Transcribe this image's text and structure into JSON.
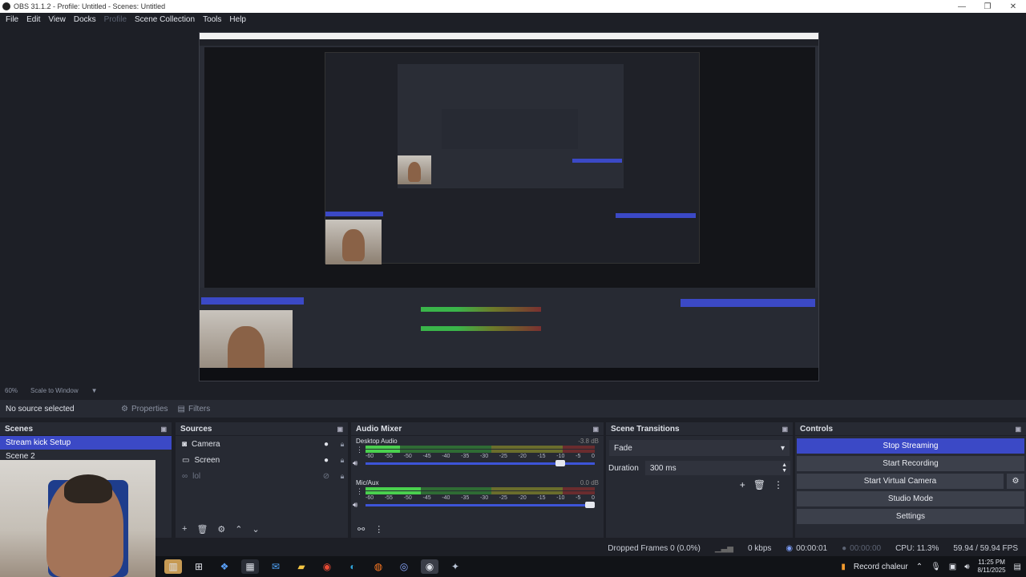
{
  "window": {
    "title": "OBS 31.1.2 - Profile: Untitled - Scenes: Untitled",
    "minimize": "—",
    "maximize": "❐",
    "close": "✕"
  },
  "menu": [
    "File",
    "Edit",
    "View",
    "Docks",
    "Profile",
    "Scene Collection",
    "Tools",
    "Help"
  ],
  "zoom": {
    "percent": "60%",
    "mode": "Scale to Window",
    "chevron": "▼"
  },
  "props": {
    "no_source": "No source selected",
    "properties": "Properties",
    "filters": "Filters"
  },
  "scenes": {
    "title": "Scenes",
    "items": [
      "Stream kick Setup",
      "Scene 2"
    ]
  },
  "sources": {
    "title": "Sources",
    "items": [
      {
        "name": "Camera",
        "icon": "camera-icon"
      },
      {
        "name": "Screen",
        "icon": "monitor-icon"
      },
      {
        "name": "lol",
        "icon": "link-icon"
      }
    ]
  },
  "mixer": {
    "title": "Audio Mixer",
    "channels": [
      {
        "name": "Desktop Audio",
        "db": "-3.8 dB",
        "level": 0.15,
        "volume": 0.87
      },
      {
        "name": "Mic/Aux",
        "db": "0.0 dB",
        "level": 0.24,
        "volume": 1.0
      }
    ],
    "scale": [
      "-60",
      "-55",
      "-50",
      "-45",
      "-40",
      "-35",
      "-30",
      "-25",
      "-20",
      "-15",
      "-10",
      "-5",
      "0"
    ]
  },
  "transitions": {
    "title": "Scene Transitions",
    "selected": "Fade",
    "duration_label": "Duration",
    "duration": "300 ms"
  },
  "controls": {
    "title": "Controls",
    "stop_streaming": "Stop Streaming",
    "start_recording": "Start Recording",
    "virtual_camera": "Start Virtual Camera",
    "studio_mode": "Studio Mode",
    "settings": "Settings"
  },
  "status": {
    "dropped": "Dropped Frames 0 (0.0%)",
    "kbps": "0 kbps",
    "stream_time": "00:00:01",
    "rec_time": "00:00:00",
    "cpu": "CPU: 11.3%",
    "fps": "59.94 / 59.94 FPS"
  },
  "taskbar": {
    "notification": "Record chaleur",
    "time": "11:25 PM",
    "date": "8/11/2025"
  },
  "colors": {
    "accent": "#3b49c6",
    "panel": "#272a33",
    "background": "#1d1f26"
  }
}
